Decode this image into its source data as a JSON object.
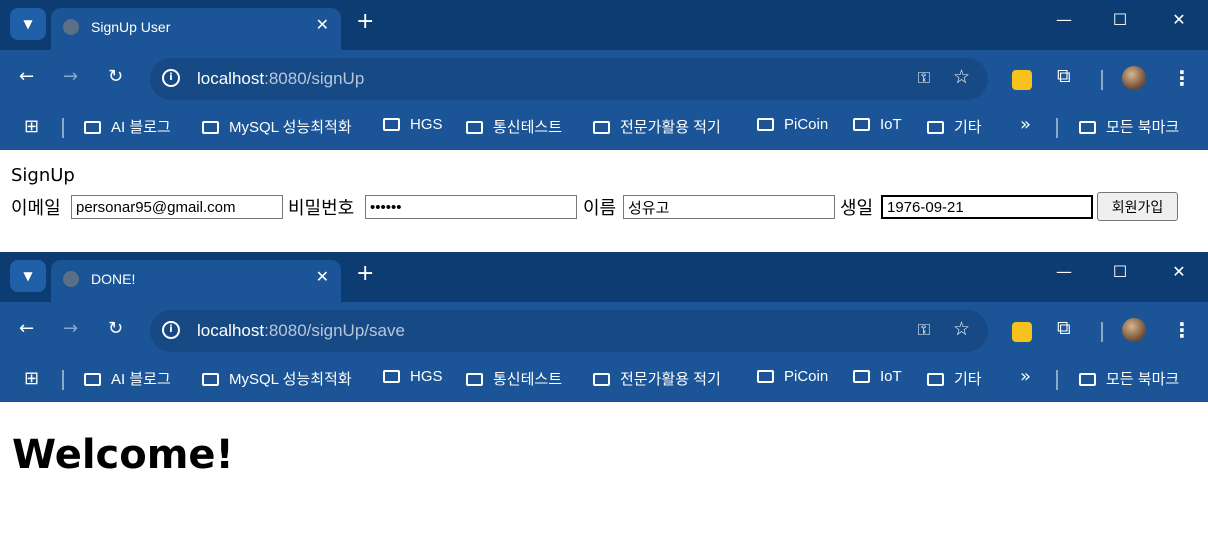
{
  "windows": [
    {
      "tab_title": "SignUp User",
      "url_host": "localhost",
      "url_path": ":8080/signUp"
    },
    {
      "tab_title": "DONE!",
      "url_host": "localhost",
      "url_path": ":8080/signUp/save"
    }
  ],
  "bookmarks": [
    "AI 블로그",
    "MySQL 성능최적화",
    "HGS",
    "통신테스트",
    "전문가활용 적기",
    "PiCoin",
    "IoT",
    "기타"
  ],
  "all_bookmarks": "모든 북마크",
  "signup_page": {
    "title": "SignUp",
    "email_label": "이메일",
    "email_value": "personar95@gmail.com",
    "password_label": "비밀번호",
    "password_value": "••••••",
    "name_label": "이름",
    "name_value": "성유고",
    "birth_label": "생일",
    "birth_value": "1976-09-21",
    "submit_label": "회원가입"
  },
  "done_page": {
    "heading": "Welcome!"
  },
  "icons": {
    "tab_menu": "chevron-down-icon",
    "new_tab": "plus-icon",
    "back": "arrow-left-icon",
    "forward": "arrow-right-icon",
    "reload": "reload-icon",
    "site_info": "info-icon",
    "password_key": "key-icon",
    "bookmark_star": "star-icon",
    "extensions": "puzzle-icon",
    "menu": "kebab-icon",
    "apps": "apps-grid-icon",
    "folder": "folder-icon"
  },
  "colors": {
    "tab_strip": "#0d3c73",
    "toolbar": "#1b5597",
    "omnibox": "#174a85"
  }
}
